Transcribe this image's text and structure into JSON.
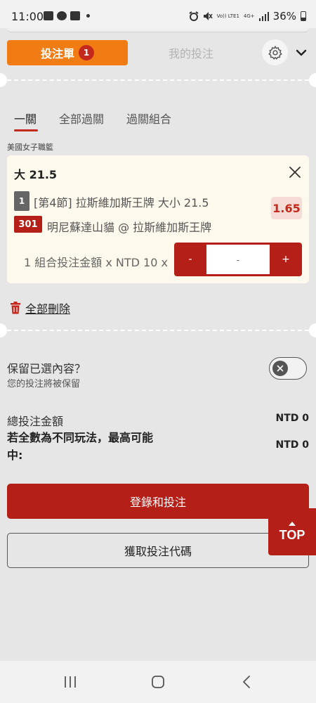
{
  "status_bar": {
    "time": "11:00",
    "battery": "36%",
    "network_small": "Vo)) LTE1",
    "network_type": "4G+"
  },
  "header": {
    "betslip_label": "投注單",
    "betslip_count": "1",
    "mybets_label": "我的投注",
    "settings_icon": "gear-icon",
    "collapse_icon": "chevron-down-icon"
  },
  "bet_type_tabs": [
    {
      "label": "一關",
      "active": true
    },
    {
      "label": "全部過關",
      "active": false
    },
    {
      "label": "過關組合",
      "active": false
    }
  ],
  "bet": {
    "league": "美國女子職籃",
    "selection": "大 21.5",
    "period_badge": "1",
    "market": "[第4節] 拉斯維加斯王牌 大小 21.5",
    "odds": "1.65",
    "event_id": "301",
    "event": "明尼蘇達山貓 @ 拉斯維加斯王牌",
    "stake_label": "1 組合投注金額 x NTD 10 x",
    "stepper": {
      "minus": "-",
      "value": "-",
      "plus": "+"
    }
  },
  "delete_all_label": "全部刪除",
  "keep_selection": {
    "title": "保留已選內容？",
    "subtitle": "您的投注將被保留",
    "enabled": false
  },
  "totals": {
    "total_stake_label": "總投注金額",
    "total_stake_value": "NTD 0",
    "max_payout_label": "若全數為不同玩法，最高可能中:",
    "max_payout_value": "NTD 0"
  },
  "actions": {
    "login_bet": "登錄和投注",
    "get_code": "獲取投注代碼"
  },
  "top_button": "TOP",
  "colors": {
    "accent_orange": "#f27c14",
    "brand_red": "#b41f17",
    "badge_red": "#c5281c",
    "card_bg": "#fdf9ec"
  }
}
